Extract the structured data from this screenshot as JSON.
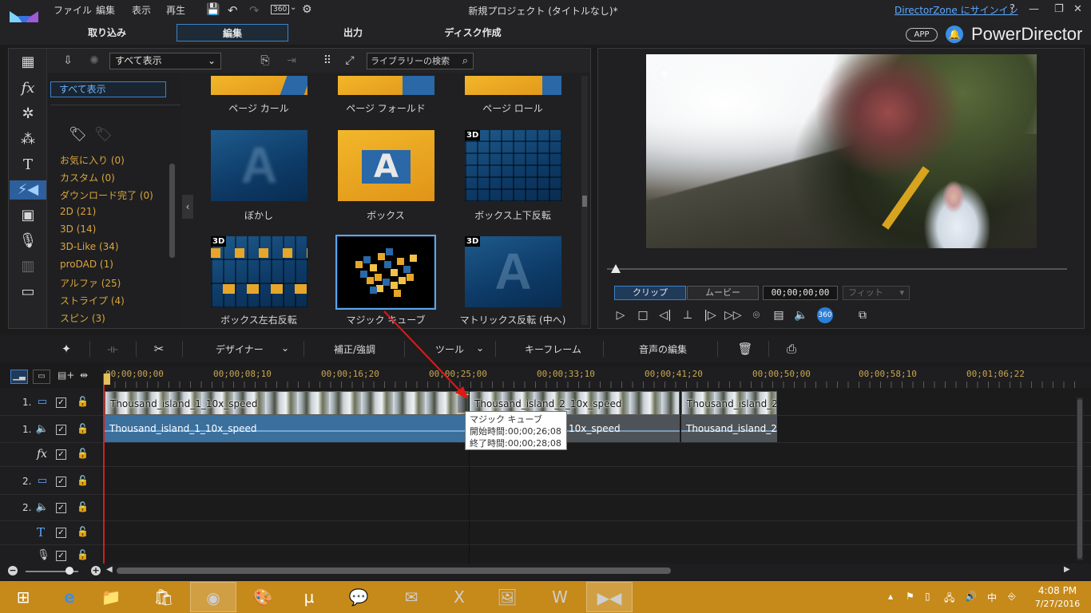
{
  "menu": [
    "ファイル",
    "編集",
    "表示",
    "再生"
  ],
  "window": {
    "title": "新規プロジェクト (タイトルなし)*",
    "signin": "DirectorZone にサインイン",
    "help": "?",
    "minimize": "—",
    "restore": "❐",
    "close": "✕",
    "zoom_360": "360"
  },
  "modes": [
    "取り込み",
    "編集",
    "出力",
    "ディスク作成"
  ],
  "brand": {
    "app_badge": "APP",
    "name": "PowerDirector"
  },
  "library": {
    "filter": "すべて表示",
    "search_placeholder": "ライブラリーの検索",
    "categories": [
      "お気に入り (0)",
      "カスタム (0)",
      "ダウンロード完了 (0)",
      "2D (21)",
      "3D (14)",
      "3D-Like (34)",
      "proDAD (1)",
      "アルファ (25)",
      "ストライプ (4)",
      "スピン (3)"
    ],
    "row0": [
      "ページ カール",
      "ページ フォールド",
      "ページ ロール"
    ],
    "row1": [
      "ぼかし",
      "ボックス",
      "ボックス上下反転"
    ],
    "row2": [
      "ボックス左右反転",
      "マジック キューブ",
      "マトリックス反転 (中へ)"
    ],
    "badge_3d": "3D",
    "letter": "A"
  },
  "preview": {
    "tab_clip": "クリップ",
    "tab_movie": "ムービー",
    "timecode": "00;00;00;00",
    "fit": "フィット",
    "btn_360": "360"
  },
  "edit_toolbar": {
    "designer": "デザイナー",
    "fix": "補正/強調",
    "tools": "ツール",
    "keyframe": "キーフレーム",
    "audio_edit": "音声の編集"
  },
  "ruler": [
    "00;00;00;00",
    "00;00;08;10",
    "00;00;16;20",
    "00;00;25;00",
    "00;00;33;10",
    "00;00;41;20",
    "00;00;50;00",
    "00;00;58;10",
    "00;01;06;22"
  ],
  "tracks": {
    "t1": "1.",
    "t2": "2.",
    "fx": "fx",
    "check": "✓"
  },
  "clips": {
    "v1": "Thousand_island_1_10x_speed",
    "v2": "Thousand_island_2_10x_speed",
    "v3": "Thousand_island_2",
    "a1": "Thousand_island_1_10x_speed",
    "a2": "10x_speed",
    "a3": "Thousand_island_2"
  },
  "tooltip": {
    "title": "マジック キューブ",
    "start": "開始時間:00;00;26;08",
    "end": "終了時間:00;00;28;08"
  },
  "taskbar": {
    "time": "4:08 PM",
    "date": "7/27/2016",
    "ime": "中"
  }
}
